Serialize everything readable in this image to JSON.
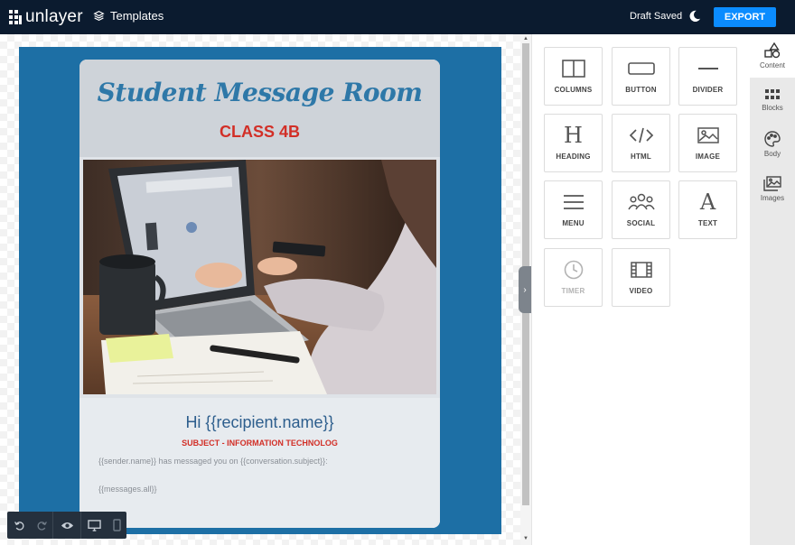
{
  "topbar": {
    "logo_text": "unlayer",
    "templates_label": "Templates",
    "status": "Draft Saved",
    "export_label": "EXPORT"
  },
  "email": {
    "title": "Student Message Room",
    "class_label": "CLASS 4B",
    "greeting": "Hi {{recipient.name}}",
    "subject": "SUBJECT - INFORMATION TECHNOLOG",
    "message_line": "{{sender.name}} has messaged you on {{conversation.subject}}:",
    "messages_line": "{{messages.all}}"
  },
  "tools": [
    {
      "label": "COLUMNS",
      "icon": "columns-icon",
      "enabled": true
    },
    {
      "label": "BUTTON",
      "icon": "button-icon",
      "enabled": true
    },
    {
      "label": "DIVIDER",
      "icon": "divider-icon",
      "enabled": true
    },
    {
      "label": "HEADING",
      "icon": "heading-icon",
      "enabled": true
    },
    {
      "label": "HTML",
      "icon": "code-icon",
      "enabled": true
    },
    {
      "label": "IMAGE",
      "icon": "image-icon",
      "enabled": true
    },
    {
      "label": "MENU",
      "icon": "menu-icon",
      "enabled": true
    },
    {
      "label": "SOCIAL",
      "icon": "social-icon",
      "enabled": true
    },
    {
      "label": "TEXT",
      "icon": "text-icon",
      "enabled": true
    },
    {
      "label": "TIMER",
      "icon": "timer-icon",
      "enabled": false
    },
    {
      "label": "VIDEO",
      "icon": "video-icon",
      "enabled": true
    }
  ],
  "sidebar": {
    "items": [
      {
        "label": "Content",
        "icon": "shapes-icon",
        "active": true
      },
      {
        "label": "Blocks",
        "icon": "blocks-icon",
        "active": false
      },
      {
        "label": "Body",
        "icon": "palette-icon",
        "active": false
      },
      {
        "label": "Images",
        "icon": "images-icon",
        "active": false
      }
    ]
  },
  "colors": {
    "topbar": "#0b1b2f",
    "accent": "#0b8cff",
    "email_background": "#1d6fa5",
    "title": "#2e78a8",
    "red": "#d22f27"
  }
}
